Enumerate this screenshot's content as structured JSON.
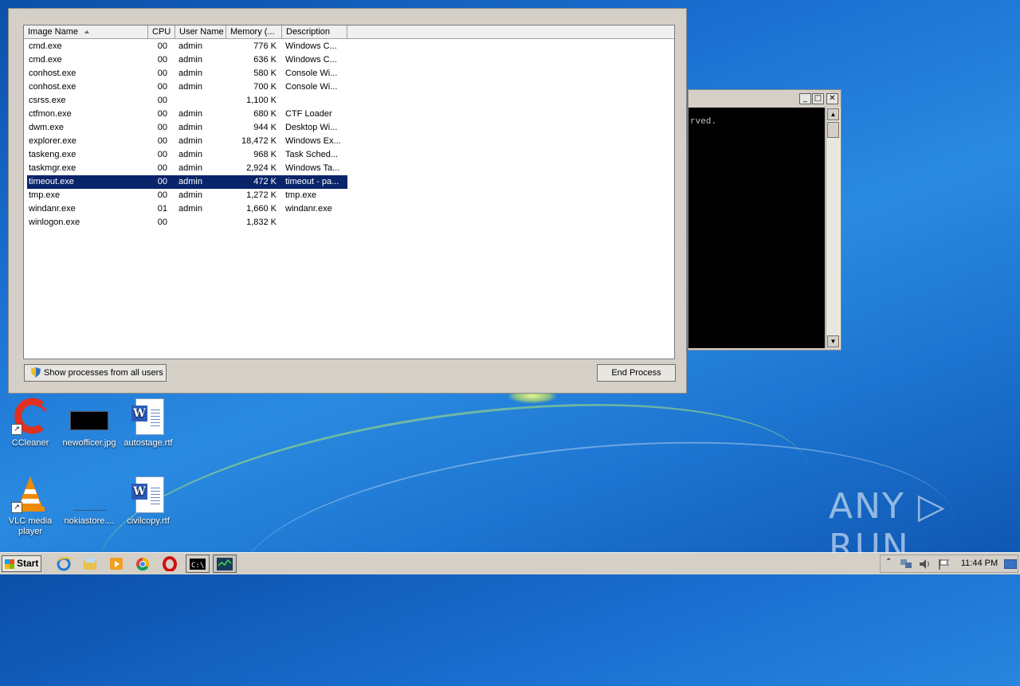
{
  "task_manager": {
    "columns": [
      "Image Name",
      "CPU",
      "User Name",
      "Memory (...",
      "Description"
    ],
    "processes": [
      {
        "name": "cmd.exe",
        "cpu": "00",
        "user": "admin",
        "memory": "776 K",
        "description": "Windows C..."
      },
      {
        "name": "cmd.exe",
        "cpu": "00",
        "user": "admin",
        "memory": "636 K",
        "description": "Windows C..."
      },
      {
        "name": "conhost.exe",
        "cpu": "00",
        "user": "admin",
        "memory": "580 K",
        "description": "Console Wi..."
      },
      {
        "name": "conhost.exe",
        "cpu": "00",
        "user": "admin",
        "memory": "700 K",
        "description": "Console Wi..."
      },
      {
        "name": "csrss.exe",
        "cpu": "00",
        "user": "",
        "memory": "1,100 K",
        "description": ""
      },
      {
        "name": "ctfmon.exe",
        "cpu": "00",
        "user": "admin",
        "memory": "680 K",
        "description": "CTF Loader"
      },
      {
        "name": "dwm.exe",
        "cpu": "00",
        "user": "admin",
        "memory": "944 K",
        "description": "Desktop Wi..."
      },
      {
        "name": "explorer.exe",
        "cpu": "00",
        "user": "admin",
        "memory": "18,472 K",
        "description": "Windows Ex..."
      },
      {
        "name": "taskeng.exe",
        "cpu": "00",
        "user": "admin",
        "memory": "968 K",
        "description": "Task Sched..."
      },
      {
        "name": "taskmgr.exe",
        "cpu": "00",
        "user": "admin",
        "memory": "2,924 K",
        "description": "Windows Ta..."
      },
      {
        "name": "timeout.exe",
        "cpu": "00",
        "user": "admin",
        "memory": "472 K",
        "description": "timeout - pa...",
        "selected": true
      },
      {
        "name": "tmp.exe",
        "cpu": "00",
        "user": "admin",
        "memory": "1,272 K",
        "description": "tmp.exe"
      },
      {
        "name": "windanr.exe",
        "cpu": "01",
        "user": "admin",
        "memory": "1,660 K",
        "description": "windanr.exe"
      },
      {
        "name": "winlogon.exe",
        "cpu": "00",
        "user": "",
        "memory": "1,832 K",
        "description": ""
      }
    ],
    "show_all_label": "Show processes from all users",
    "end_process_label": "End Process"
  },
  "cmd": {
    "text": "rved.",
    "buttons": [
      "_",
      "□",
      "✕"
    ]
  },
  "desktop_icons": [
    {
      "label": "CCleaner",
      "icon": "ccleaner-icon"
    },
    {
      "label": "newofficer.jpg",
      "icon": "image-file-icon"
    },
    {
      "label": "autostage.rtf",
      "icon": "word-document-icon"
    },
    {
      "label": "VLC media player",
      "icon": "vlc-icon"
    },
    {
      "label": "nokiastore....",
      "icon": "file-icon"
    },
    {
      "label": "civilcopy.rtf",
      "icon": "word-document-icon"
    }
  ],
  "watermark": "ANY ▷ RUN",
  "taskbar": {
    "start_label": "Start",
    "clock": "11:44 PM"
  },
  "colors": {
    "selection": "#0a246a",
    "window_face": "#d4d0c8",
    "desktop_blue": "#1a6fd1"
  }
}
